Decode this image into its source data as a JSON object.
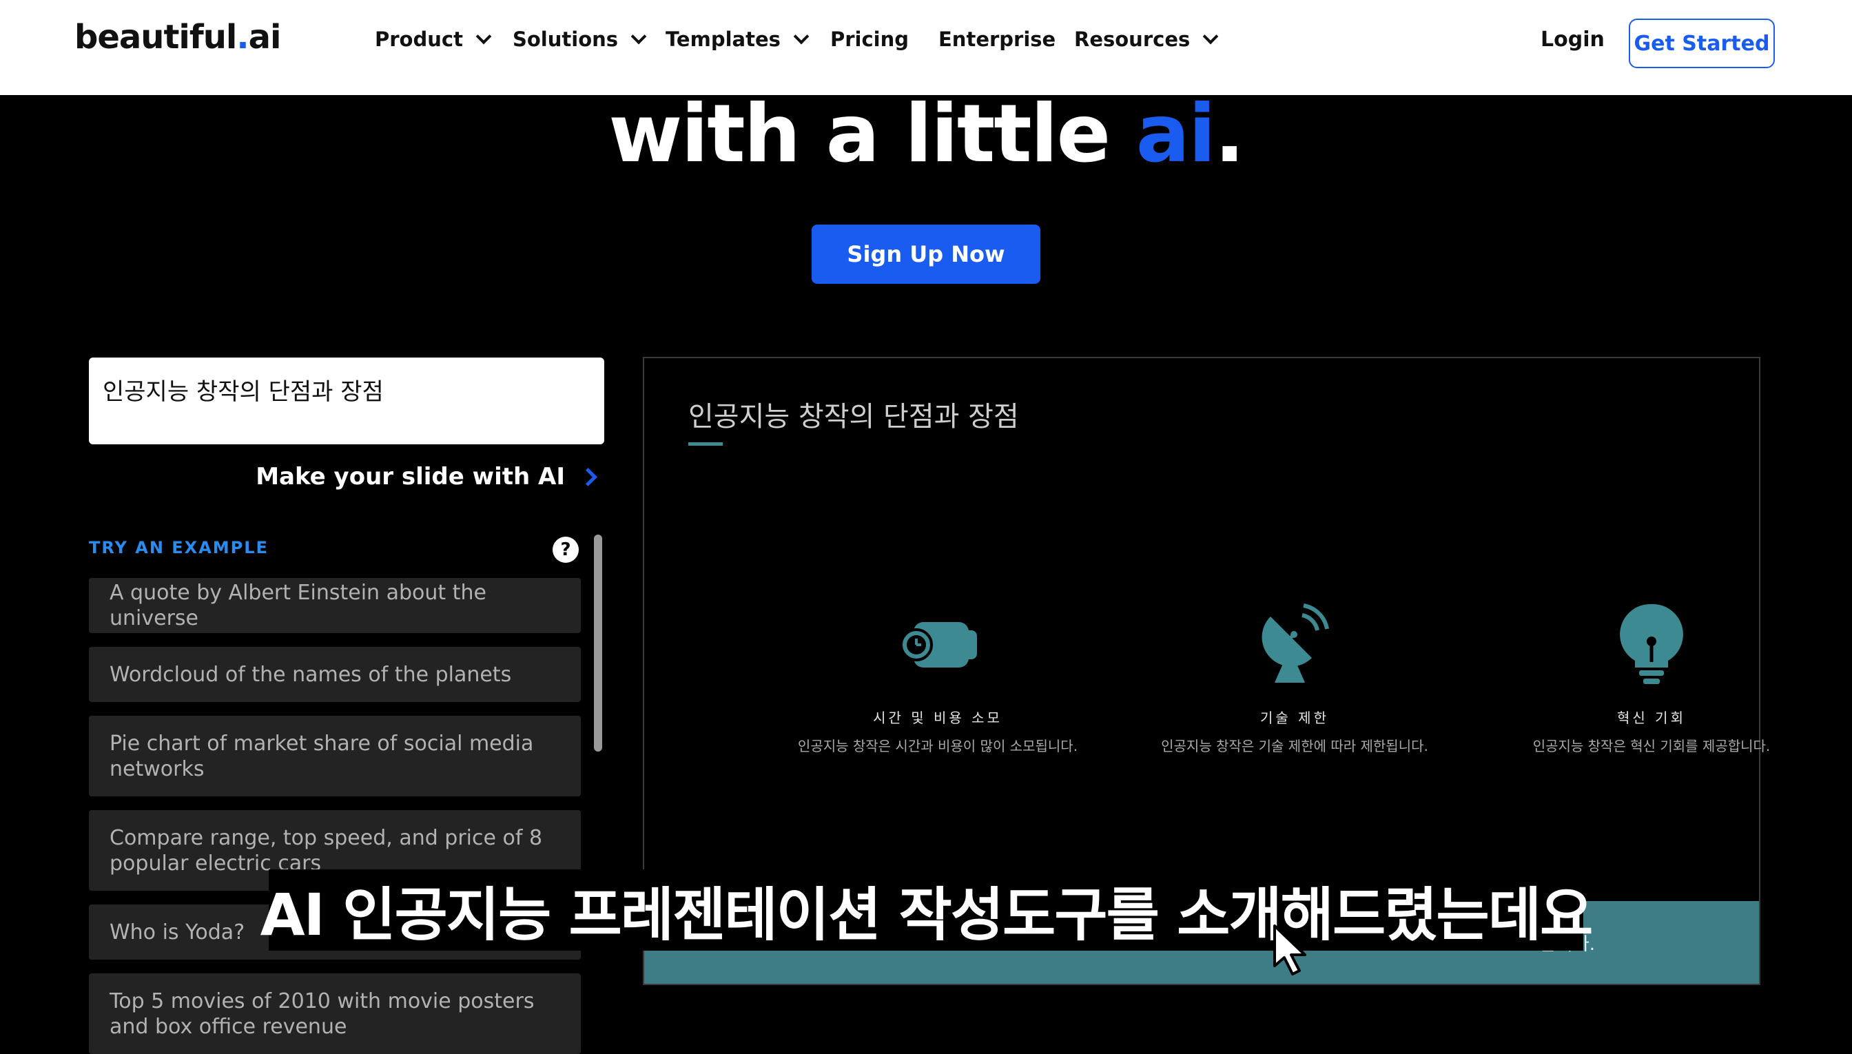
{
  "nav": {
    "logo_main": "beautiful",
    "logo_dot": ".",
    "logo_suffix": "ai",
    "items": [
      {
        "label": "Product",
        "has_dropdown": true
      },
      {
        "label": "Solutions",
        "has_dropdown": true
      },
      {
        "label": "Templates",
        "has_dropdown": true
      },
      {
        "label": "Pricing",
        "has_dropdown": false
      },
      {
        "label": "Enterprise",
        "has_dropdown": false
      },
      {
        "label": "Resources",
        "has_dropdown": true
      }
    ],
    "login": "Login",
    "get_started": "Get Started"
  },
  "hero": {
    "headline_prefix": "with a little ",
    "headline_accent": "ai",
    "headline_suffix": ".",
    "signup_button": "Sign Up Now"
  },
  "generator": {
    "prompt_value": "인공지능 창작의 단점과 장점",
    "make_slide_label": "Make your slide with AI",
    "try_example_label": "TRY AN EXAMPLE",
    "help_icon": "?",
    "examples": [
      "A quote by Albert Einstein about the universe",
      "Wordcloud of the names of the planets",
      "Pie chart of market share of social media networks",
      "Compare range, top speed, and price of 8 popular electric cars",
      "Who is Yoda?",
      "Top 5 movies of 2010 with movie posters and box office revenue"
    ]
  },
  "slide": {
    "title": "인공지능 창작의 단점과 장점",
    "columns": [
      {
        "icon": "watch-icon",
        "heading": "시간 및 비용 소모",
        "description": "인공지능 창작은 시간과 비용이 많이 소모됩니다."
      },
      {
        "icon": "satellite-dish-icon",
        "heading": "기술 제한",
        "description": "인공지능 창작은 기술 제한에 따라 제한됩니다."
      },
      {
        "icon": "lightbulb-icon",
        "heading": "혁신 기회",
        "description": "인공지능 창작은 혁신 기회를 제공합니다."
      }
    ],
    "band_text": "습니다.",
    "accent_color": "#3e7d86"
  },
  "subtitle": "AI 인공지능 프레젠테이션 작성도구를 소개해드렸는데요",
  "colors": {
    "brand_blue": "#1b5cf0",
    "teal": "#3e8a93"
  }
}
